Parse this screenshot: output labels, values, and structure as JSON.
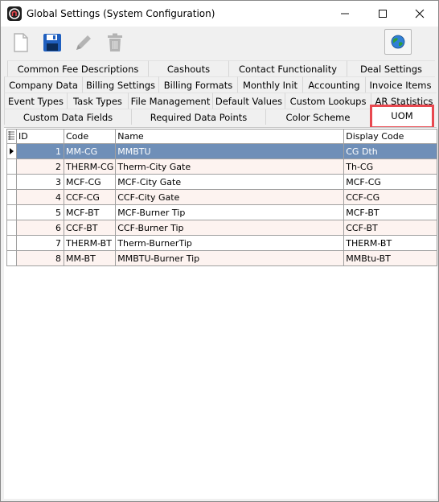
{
  "window": {
    "title": "Global Settings (System Configuration)"
  },
  "toolbar": {
    "icons": [
      "new-document-icon",
      "save-icon",
      "edit-pencil-icon",
      "delete-trash-icon",
      "globe-icon"
    ],
    "colors": {
      "save": "#1f5fbf",
      "disabled": "#b4b4b4"
    }
  },
  "tabs": {
    "row1": [
      "Common Fee Descriptions",
      "Cashouts",
      "Contact Functionality",
      "Deal Settings"
    ],
    "row2": [
      "Company Data",
      "Billing Settings",
      "Billing Formats",
      "Monthly Init",
      "Accounting",
      "Invoice Items"
    ],
    "row3": [
      "Event Types",
      "Task Types",
      "File Management",
      "Default Values",
      "Custom Lookups",
      "AR Statistics"
    ],
    "row4": [
      "Custom Data Fields",
      "Required Data Points",
      "Color Scheme",
      "UOM"
    ],
    "active": "UOM"
  },
  "grid": {
    "columns": [
      "ID",
      "Code",
      "Name",
      "Display Code"
    ],
    "rows": [
      {
        "id": "1",
        "code": "MM-CG",
        "name": "MMBTU",
        "display": "CG Dth"
      },
      {
        "id": "2",
        "code": "THERM-CG",
        "name": "Therm-City Gate",
        "display": "Th-CG"
      },
      {
        "id": "3",
        "code": "MCF-CG",
        "name": "MCF-City Gate",
        "display": "MCF-CG"
      },
      {
        "id": "4",
        "code": "CCF-CG",
        "name": "CCF-City Gate",
        "display": "CCF-CG"
      },
      {
        "id": "5",
        "code": "MCF-BT",
        "name": "MCF-Burner Tip",
        "display": "MCF-BT"
      },
      {
        "id": "6",
        "code": "CCF-BT",
        "name": "CCF-Burner Tip",
        "display": "CCF-BT"
      },
      {
        "id": "7",
        "code": "THERM-BT",
        "name": "Therm-BurnerTip",
        "display": "THERM-BT"
      },
      {
        "id": "8",
        "code": "MM-BT",
        "name": "MMBTU-Burner Tip",
        "display": "MMBtu-BT"
      }
    ],
    "selected_row": "1",
    "colors": {
      "selected": "#6f8fb8",
      "alt_row": "#fdf3f0",
      "highlight_box": "#e8484f"
    }
  }
}
